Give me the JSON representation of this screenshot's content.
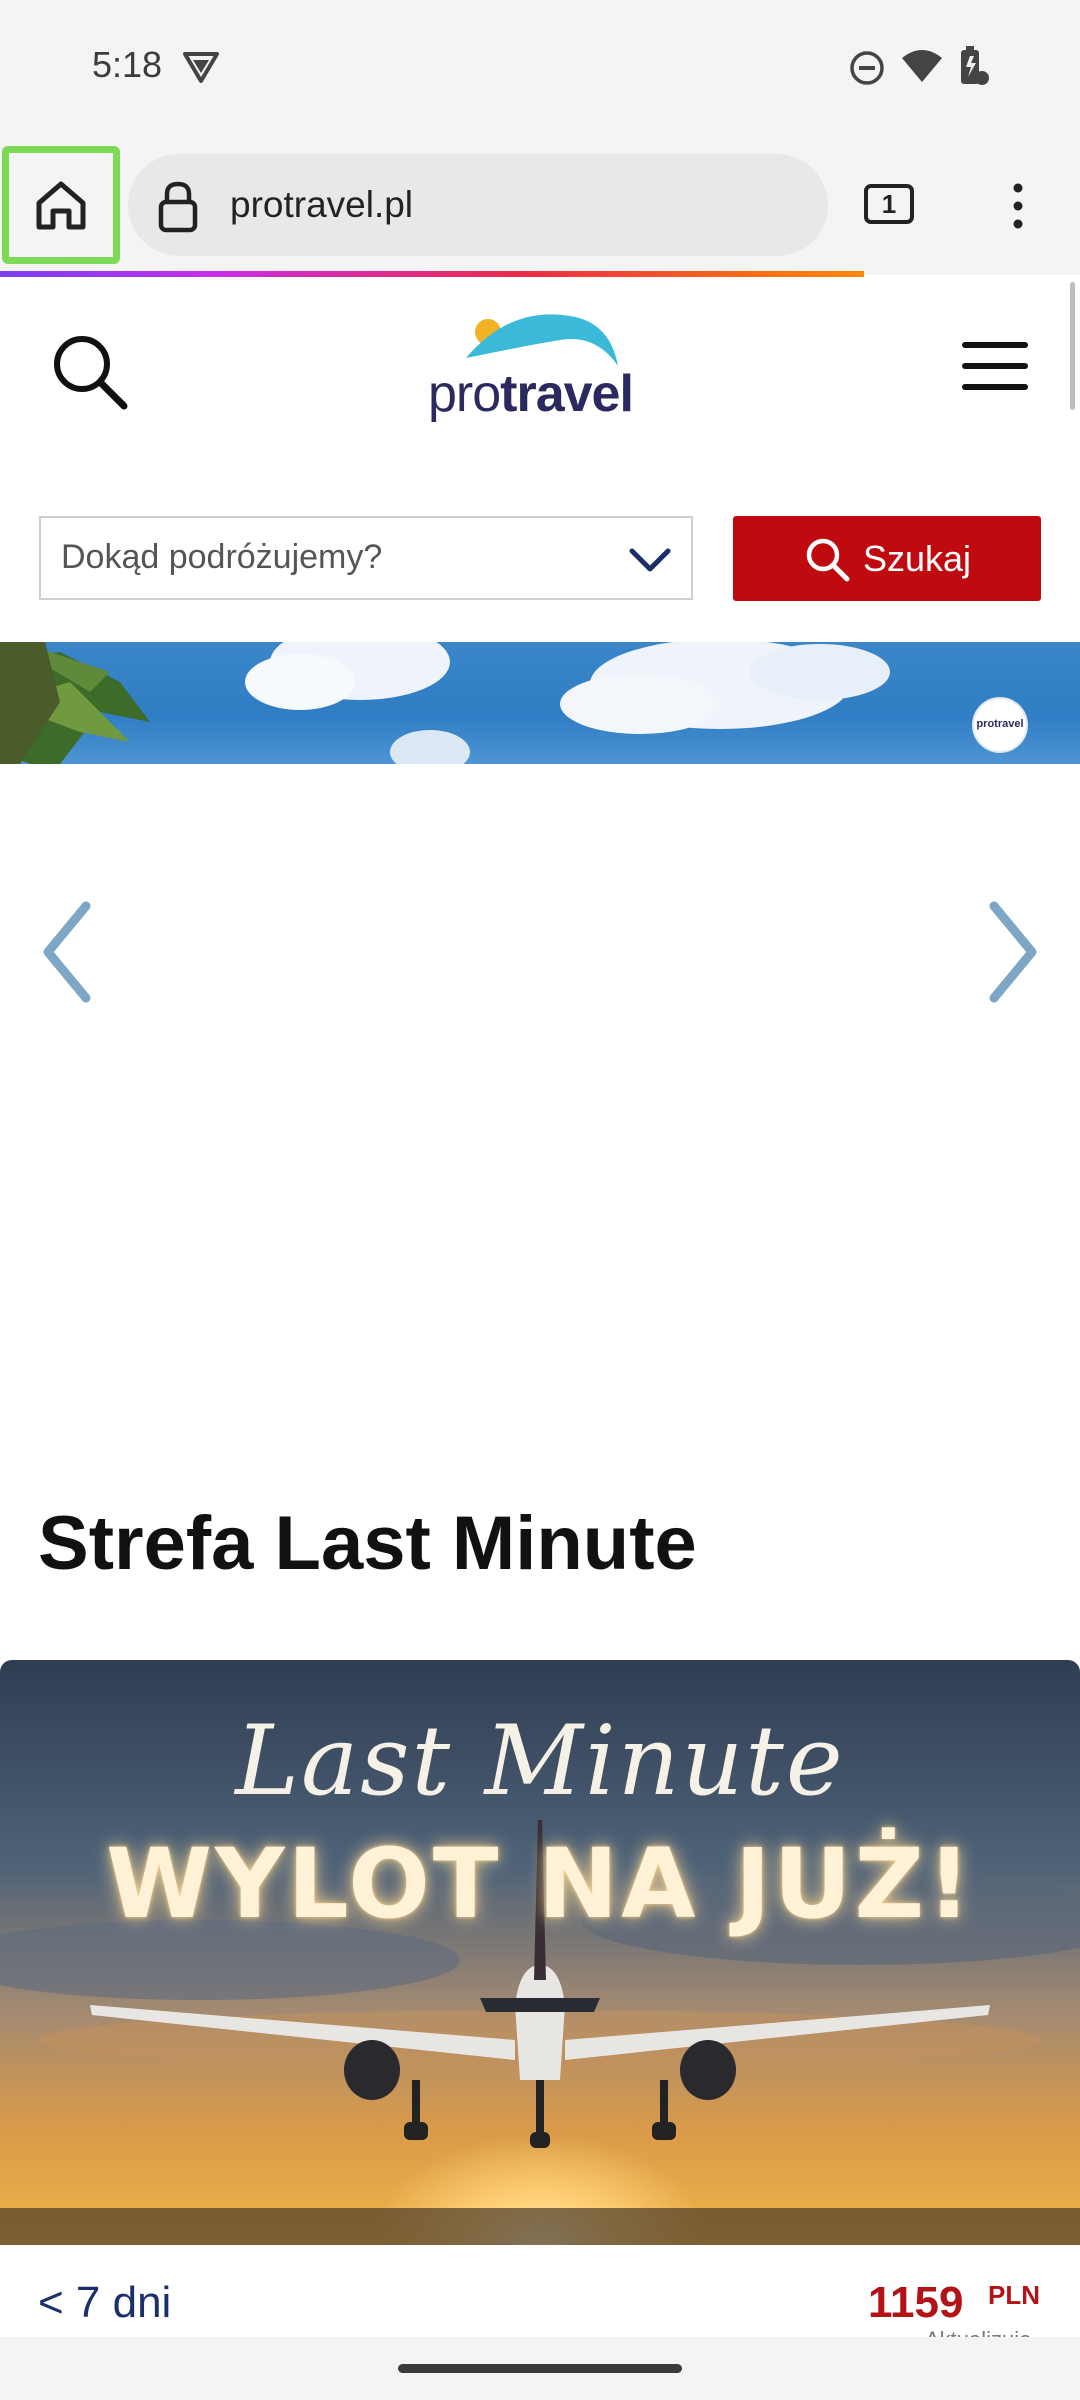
{
  "status_bar": {
    "time": "5:18"
  },
  "browser": {
    "url": "protravel.pl",
    "tab_count": "1"
  },
  "site": {
    "logo_pro": "pro",
    "logo_travel": "travel"
  },
  "search": {
    "placeholder": "Dokąd podróżujemy?",
    "button_label": "Szukaj"
  },
  "banner": {
    "badge_text": "protravel"
  },
  "section": {
    "title": "Strefa Last Minute"
  },
  "promo": {
    "script_text": "Last Minute",
    "headline": "WYLOT NA JUŻ!"
  },
  "offer": {
    "duration": "< 7 dni",
    "price": "1159",
    "currency": "PLN",
    "updated": "Aktualizuje"
  },
  "colors": {
    "accent_red": "#bf0a10",
    "price_red": "#b31217",
    "highlight_green": "#7ed957",
    "logo_navy": "#2b2a5e",
    "logo_teal": "#3bb9d8"
  }
}
